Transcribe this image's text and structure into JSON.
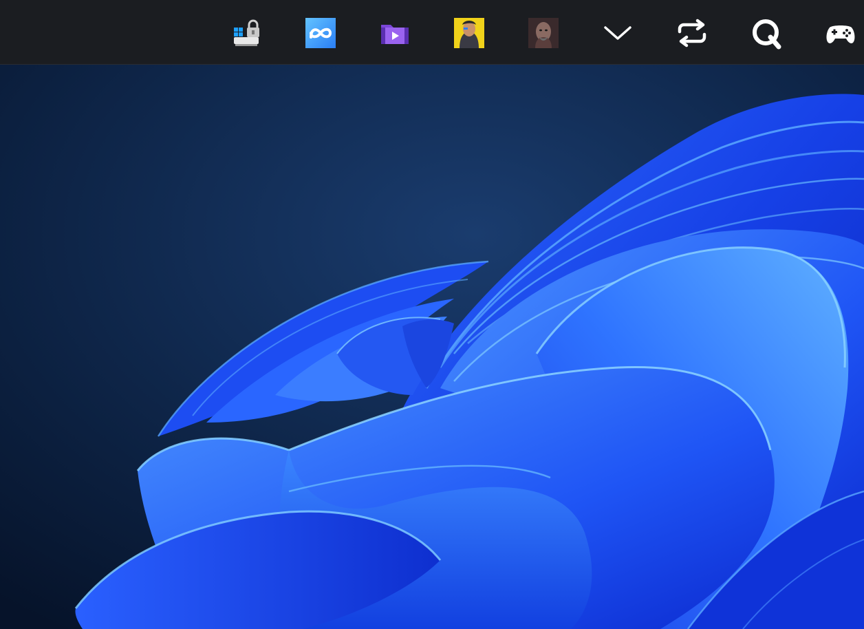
{
  "taskbar": {
    "tray_icons": [
      {
        "name": "windows-lock-drive-icon"
      },
      {
        "name": "meta-icon"
      },
      {
        "name": "video-folder-icon"
      },
      {
        "name": "game-character-yellow-icon"
      },
      {
        "name": "game-character-dark-icon"
      },
      {
        "name": "chevron-down-icon"
      },
      {
        "name": "sync-arrows-icon"
      },
      {
        "name": "q-app-icon"
      },
      {
        "name": "gamepad-icon"
      }
    ]
  },
  "wallpaper": {
    "name": "windows-11-bloom",
    "colors": {
      "background_dark": "#07152b",
      "background_mid": "#163463",
      "bloom_deep": "#0a2fd6",
      "bloom_mid": "#1f5bff",
      "bloom_light": "#3f8dff",
      "bloom_highlight": "#6ec3ff"
    }
  }
}
